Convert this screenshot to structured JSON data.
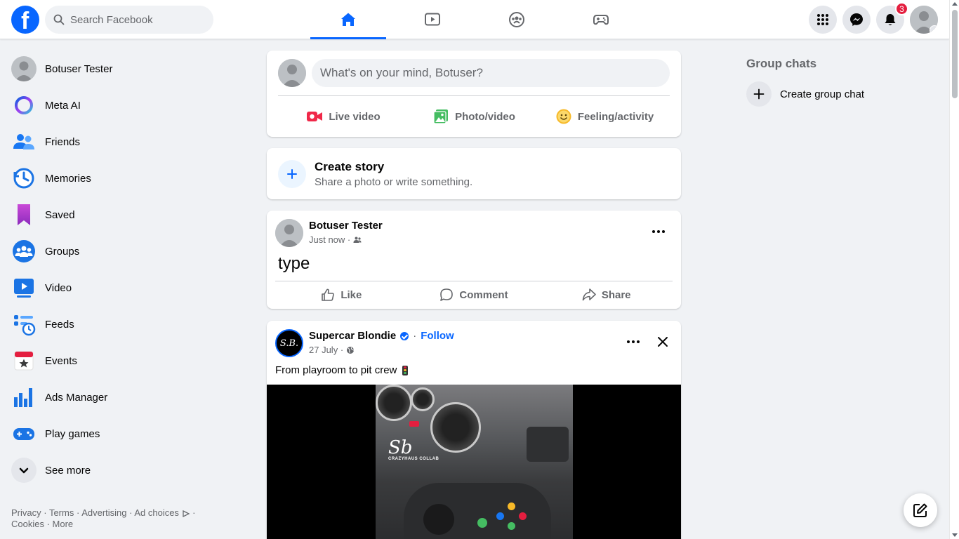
{
  "topbar": {
    "logo_letter": "f",
    "search_placeholder": "Search Facebook",
    "nav_tabs": [
      {
        "name": "home",
        "active": true
      },
      {
        "name": "video",
        "active": false
      },
      {
        "name": "groups",
        "active": false
      },
      {
        "name": "gaming",
        "active": false
      }
    ],
    "notifications_count": "3"
  },
  "sidebar": {
    "items": [
      {
        "label": "Botuser Tester",
        "icon": "profile-avatar"
      },
      {
        "label": "Meta AI",
        "icon": "meta-ai-icon"
      },
      {
        "label": "Friends",
        "icon": "friends-icon"
      },
      {
        "label": "Memories",
        "icon": "memories-icon"
      },
      {
        "label": "Saved",
        "icon": "saved-icon"
      },
      {
        "label": "Groups",
        "icon": "groups-icon"
      },
      {
        "label": "Video",
        "icon": "video-icon"
      },
      {
        "label": "Feeds",
        "icon": "feeds-icon"
      },
      {
        "label": "Events",
        "icon": "events-icon"
      },
      {
        "label": "Ads Manager",
        "icon": "ads-manager-icon"
      },
      {
        "label": "Play games",
        "icon": "play-games-icon"
      },
      {
        "label": "See more",
        "icon": "chevron-down-icon"
      }
    ],
    "footer": {
      "privacy": "Privacy",
      "terms": "Terms",
      "advertising": "Advertising",
      "ad_choices": "Ad choices",
      "cookies": "Cookies",
      "more": "More"
    }
  },
  "composer": {
    "placeholder": "What's on your mind, Botuser?",
    "actions": [
      "Live video",
      "Photo/video",
      "Feeling/activity"
    ]
  },
  "story": {
    "title": "Create story",
    "subtitle": "Share a photo or write something."
  },
  "posts": [
    {
      "author": "Botuser Tester",
      "time": "Just now",
      "text": "type",
      "actions": [
        "Like",
        "Comment",
        "Share"
      ]
    },
    {
      "author": "Supercar Blondie",
      "follow": "Follow",
      "time": "27 July",
      "caption": "From playroom to pit crew",
      "avatar_text": "S.B.",
      "watermark": "Sb",
      "watermark_sub": "CRAZYHAUS COLLAB"
    }
  ],
  "right": {
    "group_chats_title": "Group chats",
    "create_group_chat": "Create group chat"
  },
  "colors": {
    "brand": "#0866ff",
    "background": "#f0f2f5",
    "notification": "#e41e3f"
  }
}
